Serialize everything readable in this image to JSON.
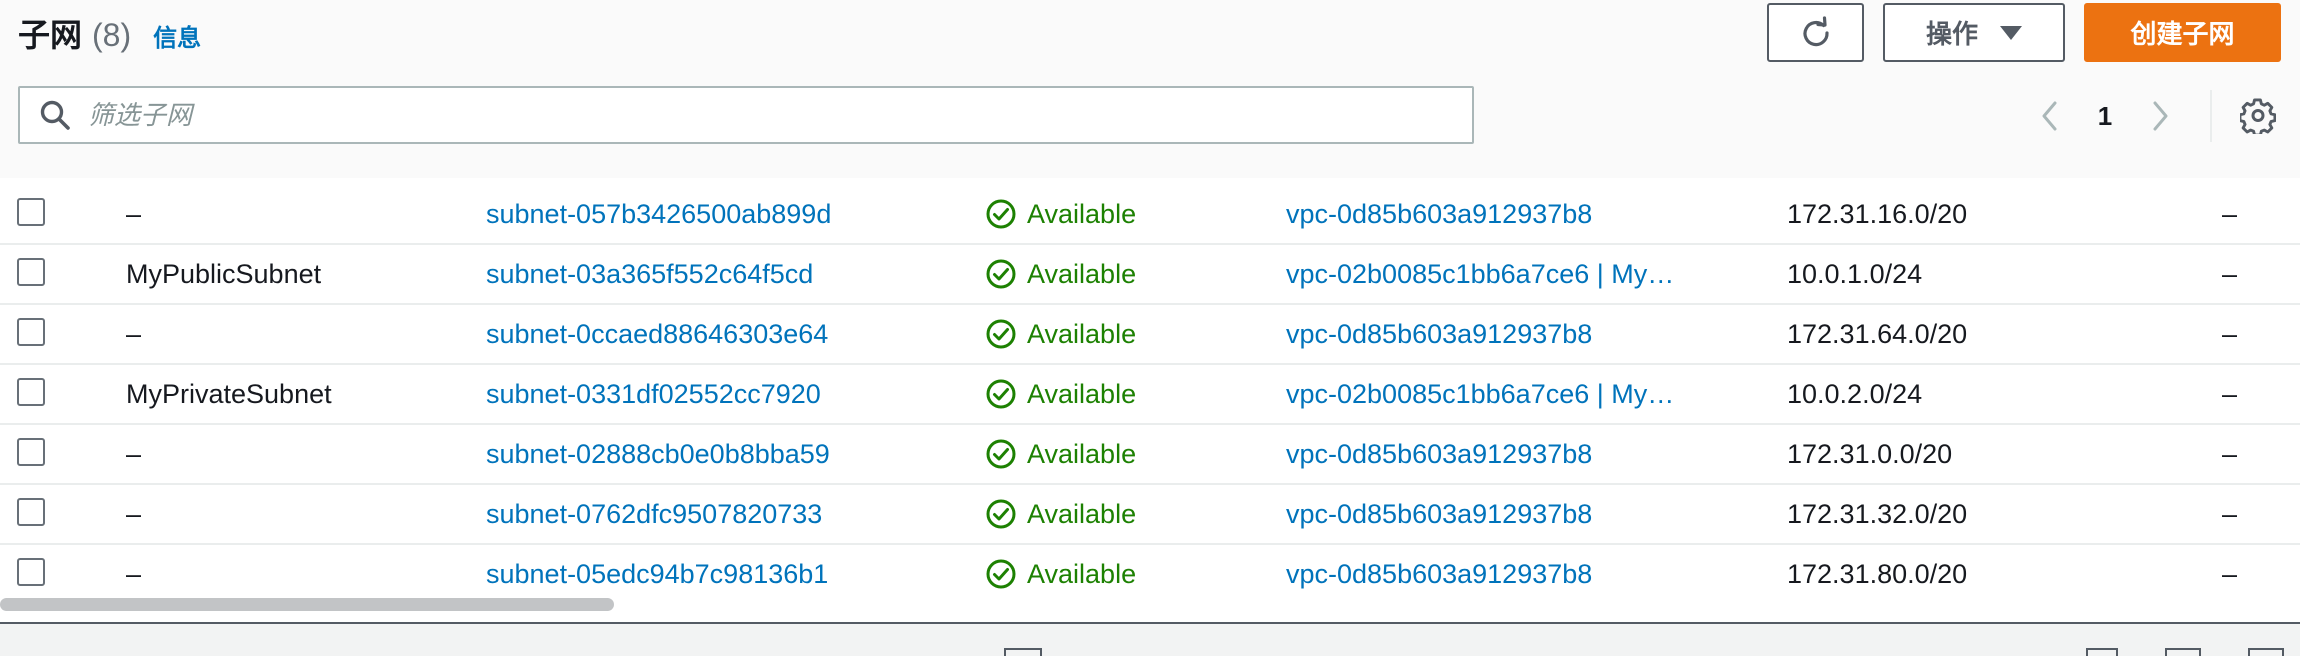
{
  "header": {
    "title": "子网",
    "count": "(8)",
    "info_link": "信息",
    "refresh_icon": "refresh-icon",
    "actions_label": "操作",
    "create_label": "创建子网"
  },
  "search": {
    "placeholder": "筛选子网",
    "value": ""
  },
  "pagination": {
    "current_page": "1"
  },
  "colors": {
    "link": "#0073bb",
    "success": "#1d8102",
    "primary": "#ec7211"
  },
  "rows": [
    {
      "name": "–",
      "subnet_id": "subnet-057b3426500ab899d",
      "state": "Available",
      "vpc": "vpc-0d85b603a912937b8",
      "cidr": "172.31.16.0/20",
      "last": "–"
    },
    {
      "name": "MyPublicSubnet",
      "subnet_id": "subnet-03a365f552c64f5cd",
      "state": "Available",
      "vpc": "vpc-02b0085c1bb6a7ce6 | My…",
      "cidr": "10.0.1.0/24",
      "last": "–"
    },
    {
      "name": "–",
      "subnet_id": "subnet-0ccaed88646303e64",
      "state": "Available",
      "vpc": "vpc-0d85b603a912937b8",
      "cidr": "172.31.64.0/20",
      "last": "–"
    },
    {
      "name": "MyPrivateSubnet",
      "subnet_id": "subnet-0331df02552cc7920",
      "state": "Available",
      "vpc": "vpc-02b0085c1bb6a7ce6 | My…",
      "cidr": "10.0.2.0/24",
      "last": "–"
    },
    {
      "name": "–",
      "subnet_id": "subnet-02888cb0e0b8bba59",
      "state": "Available",
      "vpc": "vpc-0d85b603a912937b8",
      "cidr": "172.31.0.0/20",
      "last": "–"
    },
    {
      "name": "–",
      "subnet_id": "subnet-0762dfc9507820733",
      "state": "Available",
      "vpc": "vpc-0d85b603a912937b8",
      "cidr": "172.31.32.0/20",
      "last": "–"
    },
    {
      "name": "–",
      "subnet_id": "subnet-05edc94b7c98136b1",
      "state": "Available",
      "vpc": "vpc-0d85b603a912937b8",
      "cidr": "172.31.80.0/20",
      "last": "–"
    }
  ]
}
